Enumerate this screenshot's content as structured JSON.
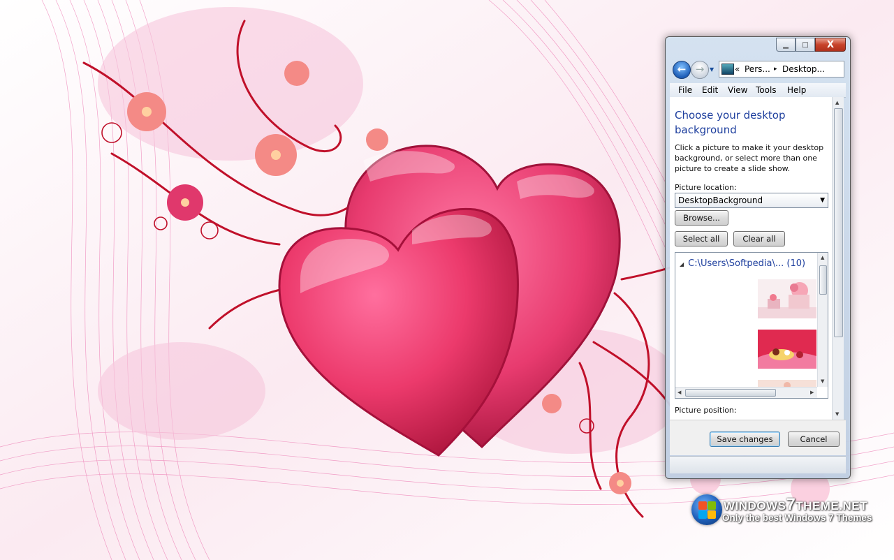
{
  "window": {
    "caption_buttons": {
      "minimize": "▁",
      "maximize": "□",
      "close": "X"
    },
    "address": {
      "chevron": "«",
      "crumb1": "Pers...",
      "separator": "▸",
      "crumb2": "Desktop..."
    },
    "menu": [
      "File",
      "Edit",
      "View",
      "Tools",
      "Help"
    ],
    "heading": "Choose your desktop background",
    "description": "Click a picture to make it your desktop background, or select more than one picture to create a slide show.",
    "picture_location_label": "Picture location:",
    "picture_location_value": "DesktopBackground",
    "browse_label": "Browse...",
    "select_all_label": "Select all",
    "clear_all_label": "Clear all",
    "group_header": "C:\\Users\\Softpedia\\... (10)",
    "picture_position_label": "Picture position:",
    "save_label": "Save changes",
    "cancel_label": "Cancel"
  },
  "watermark": {
    "title_part1": "WINDOWS",
    "title_digit": "7",
    "title_part2": "THEME.NET",
    "tagline": "Only the best Windows 7 Themes"
  },
  "colors": {
    "accent_link": "#1e3f9e",
    "heart": "#e63a6e",
    "swirl": "#c0102a"
  }
}
